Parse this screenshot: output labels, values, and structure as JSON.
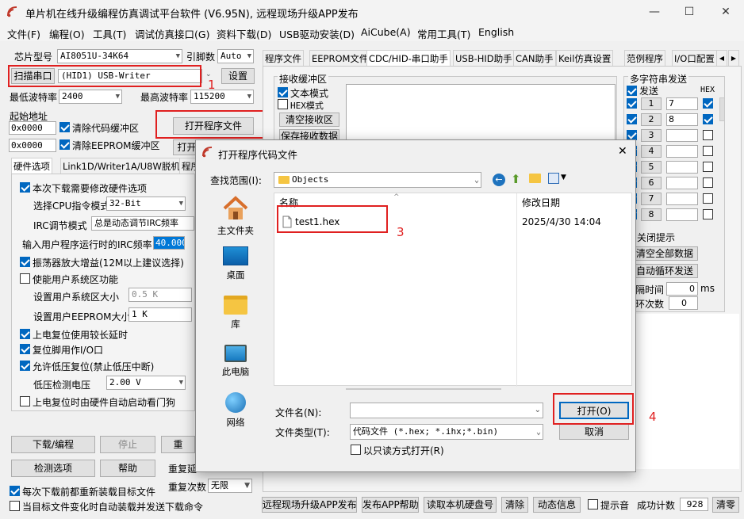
{
  "window": {
    "title": "单片机在线升级编程仿真调试平台软件 (V6.95N), 远程现场升级APP发布",
    "minimize": "—",
    "maximize": "☐",
    "close": "✕"
  },
  "menu": [
    "文件(F)",
    "编程(O)",
    "工具(T)",
    "调试仿真接口(G)",
    "资料下载(D)",
    "USB驱动安装(D)",
    "AiCube(A)",
    "常用工具(T)",
    "English"
  ],
  "left": {
    "chip_label": "芯片型号",
    "chip_value": "AI8051U-34K64",
    "pins_label": "引脚数",
    "pins_value": "Auto",
    "scan_port_button": "扫描串口",
    "port_value": "(HID1) USB-Writer",
    "settings_button": "设置",
    "min_baud_label": "最低波特率",
    "min_baud_value": "2400",
    "max_baud_label": "最高波特率",
    "max_baud_value": "115200",
    "start_addr_label": "起始地址",
    "addr1": "0x0000",
    "clear_code_label": "清除代码缓冲区",
    "addr2": "0x0000",
    "clear_eeprom_label": "清除EEPROM缓冲区",
    "open_program_button": "打开程序文件",
    "open_partial": "打开",
    "tabs": [
      "硬件选项",
      "Link1D/Writer1A/U8W脱机",
      "程序"
    ],
    "options": {
      "modify_hw": "本次下载需要修改硬件选项",
      "cpu_mode_label": "选择CPU指令模式",
      "cpu_mode_value": "32-Bit",
      "irc_mode_label": "IRC调节模式",
      "irc_mode_value": "总是动态调节IRC频率",
      "irc_freq_label": "输入用户程序运行时的IRC频率",
      "irc_freq_value": "40.000",
      "osc_gain": "振荡器放大增益(12M以上建议选择)",
      "enable_sys": "使能用户系统区功能",
      "sys_size_label": "设置用户系统区大小",
      "sys_size_value": "0.5 K",
      "eeprom_size_label": "设置用户EEPROM大小",
      "eeprom_size_value": "1   K",
      "power_delay": "上电复位使用较长延时",
      "reset_io": "复位脚用作I/O口",
      "low_voltage_reset": "允许低压复位(禁止低压中断)",
      "lv_label": "低压检测电压",
      "lv_value": "2.00 V",
      "watchdog": "上电复位时由硬件自动启动看门狗"
    },
    "download_button": "下载/编程",
    "stop_button": "停止",
    "retry_partial": "重",
    "check_button": "检测选项",
    "help_button": "帮助",
    "repeat_delay_label": "重复延",
    "repeat_count_label": "重复次数",
    "repeat_count_value": "无限",
    "reload_each": "每次下载前都重新装载目标文件",
    "auto_reload": "当目标文件变化时自动装载并发送下载命令"
  },
  "right": {
    "tabs": [
      "程序文件",
      "EEPROM文件",
      "CDC/HID-串口助手",
      "USB-HID助手",
      "CAN助手",
      "Keil仿真设置",
      "范例程序",
      "I/O口配置"
    ],
    "recv_title": "接收缓冲区",
    "text_mode": "文本模式",
    "hex_mode": "HEX模式",
    "clear_recv": "清空接收区",
    "save_recv": "保存接收数据",
    "multi_title": "多字符串发送",
    "send_label": "发送",
    "hex_label": "HEX",
    "rows": [
      {
        "n": "1",
        "v": "7",
        "hex": true
      },
      {
        "n": "2",
        "v": "8",
        "hex": true
      },
      {
        "n": "3",
        "v": "",
        "hex": false
      },
      {
        "n": "4",
        "v": "",
        "hex": false
      },
      {
        "n": "5",
        "v": "",
        "hex": false
      },
      {
        "n": "6",
        "v": "",
        "hex": false
      },
      {
        "n": "7",
        "v": "",
        "hex": false
      },
      {
        "n": "8",
        "v": "",
        "hex": false
      }
    ],
    "close_hint": "关闭提示",
    "clear_all": "清空全部数据",
    "auto_loop": "自动循环发送",
    "interval_label": "隔时间",
    "interval_value": "0",
    "interval_unit": "ms",
    "loop_label": "环次数",
    "loop_value": "0"
  },
  "bottom": {
    "publish": "远程现场升级APP发布",
    "publish_help": "发布APP帮助",
    "read_disk": "读取本机硬盘号",
    "clear": "清除",
    "dynamic": "动态信息",
    "sound": "提示音",
    "success_label": "成功计数",
    "success_value": "928",
    "zero": "清零"
  },
  "dialog": {
    "title": "打开程序代码文件",
    "close": "✕",
    "look_in_label": "查找范围(I):",
    "look_in_value": "Objects",
    "nav": [
      "主文件夹",
      "桌面",
      "库",
      "此电脑",
      "网络"
    ],
    "col_name": "名称",
    "col_date": "修改日期",
    "file_name": "test1.hex",
    "file_date": "2025/4/30 14:04",
    "filename_label": "文件名(N):",
    "filetype_label": "文件类型(T):",
    "filetype_value": "代码文件 (*.hex; *.ihx;*.bin)",
    "readonly": "以只读方式打开(R)",
    "open_button": "打开(O)",
    "cancel_button": "取消"
  },
  "annotations": [
    "1",
    "2",
    "3",
    "4"
  ],
  "colors": {
    "highlight_red": "#e02020",
    "accent_blue": "#0067c0"
  }
}
